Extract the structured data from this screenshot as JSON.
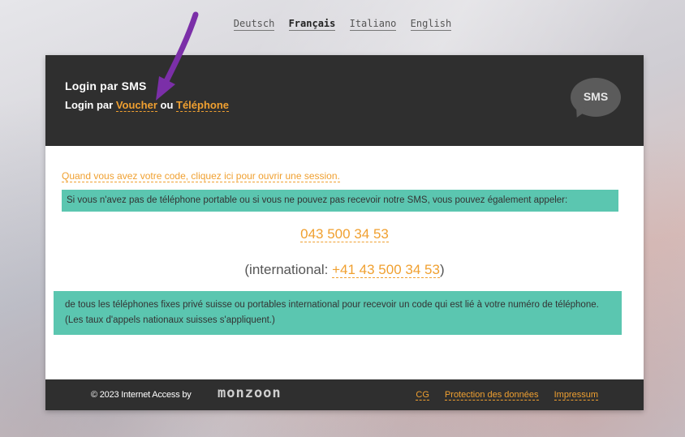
{
  "languages": [
    {
      "label": "Deutsch",
      "active": false
    },
    {
      "label": "Français",
      "active": true
    },
    {
      "label": "Italiano",
      "active": false
    },
    {
      "label": "English",
      "active": false
    }
  ],
  "header": {
    "title": "Login par SMS",
    "sub_prefix": "Login par ",
    "voucher_link": "Voucher",
    "or_text": " ou ",
    "phone_link": "Téléphone",
    "sms_badge": "SMS"
  },
  "body": {
    "session_link": "Quand vous avez votre code, cliquez ici pour ouvrir une session.",
    "note1": "Si vous n'avez pas de téléphone portable ou si vous ne pouvez pas recevoir notre SMS, vous pouvez également appeler:",
    "phone_number": "043 500 34 53",
    "intl_prefix": "(international: ",
    "intl_number": "+41 43 500 34 53",
    "intl_suffix": ")",
    "note2": "de tous les téléphones fixes privé suisse ou portables international pour recevoir un code qui est lié à votre numéro de téléphone. (Les taux d'appels nationaux suisses s'appliquent.)"
  },
  "footer": {
    "copyright": "© 2023 Internet Access by",
    "logo": "monzoon",
    "links": [
      "CG",
      "Protection des données",
      "Impressum"
    ]
  },
  "colors": {
    "accent": "#f0a030",
    "teal": "#5bc6b0",
    "dark": "#2f2f2f",
    "annotation_arrow": "#7b2fa8"
  }
}
